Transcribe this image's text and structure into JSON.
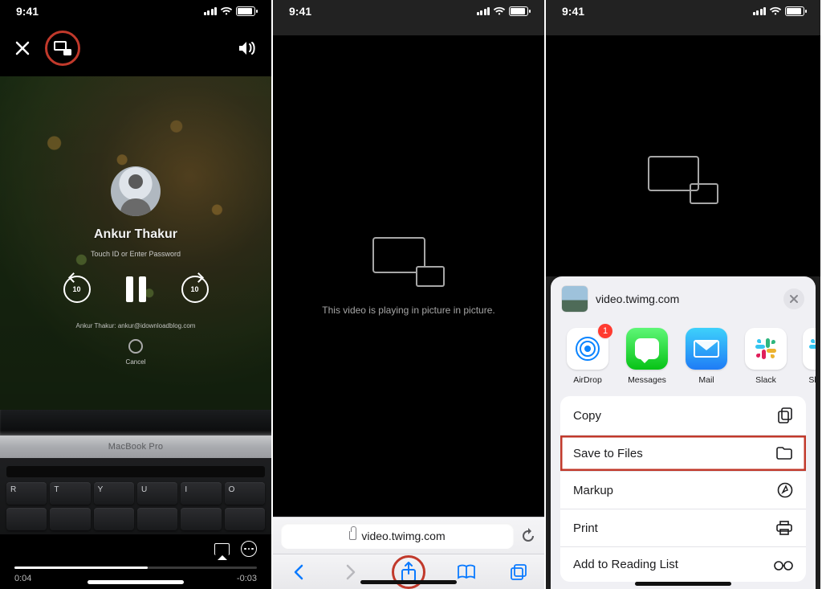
{
  "status": {
    "time": "9:41"
  },
  "panel1": {
    "video_user": "Ankur Thakur",
    "video_prompt": "Touch ID or Enter Password",
    "skip_seconds": "10",
    "meta_line": "Ankur Thakur: ankur@idownloadblog.com",
    "cancel_label": "Cancel",
    "macbook_label": "MacBook Pro",
    "keys_row1": [
      "R",
      "T",
      "Y",
      "U",
      "I",
      "O"
    ],
    "elapsed": "0:04",
    "remaining": "-0:03"
  },
  "panel2": {
    "pip_message": "This video is playing in picture in picture.",
    "url": "video.twimg.com"
  },
  "panel3": {
    "sheet_title": "video.twimg.com",
    "airdrop_badge": "1",
    "apps": {
      "airdrop": "AirDrop",
      "messages": "Messages",
      "mail": "Mail",
      "slack": "Slack",
      "slack2_partial": "Sla"
    },
    "actions": {
      "copy": "Copy",
      "save_files": "Save to Files",
      "markup": "Markup",
      "print": "Print",
      "reading_list": "Add to Reading List"
    }
  }
}
